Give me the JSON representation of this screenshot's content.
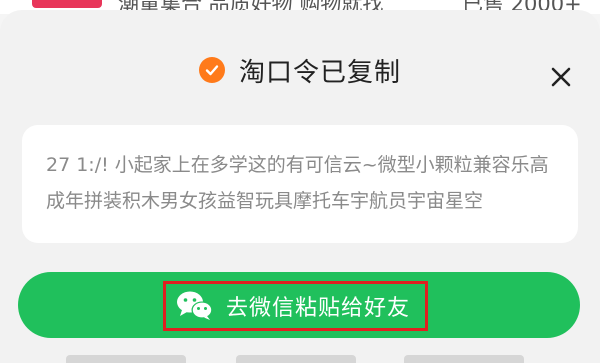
{
  "background": {
    "visible_text_left": "潮童集合 品质好物 购物就找",
    "visible_text_right": "已售 2000+"
  },
  "dialog": {
    "title": "淘口令已复制",
    "title_icon": "check-circle-icon",
    "close_icon": "close-icon",
    "content_text": "27 1:/! 小起家上在多学这的有可信云~微型小颗粒兼容乐高成年拼装积木男女孩益智玩具摩托车宇航员宇宙星空",
    "action_button_label": "去微信粘贴给好友",
    "action_button_icon": "wechat-icon"
  },
  "colors": {
    "accent_orange": "#ff7a1a",
    "wechat_green": "#20c05c",
    "highlight_red": "#e02020"
  }
}
